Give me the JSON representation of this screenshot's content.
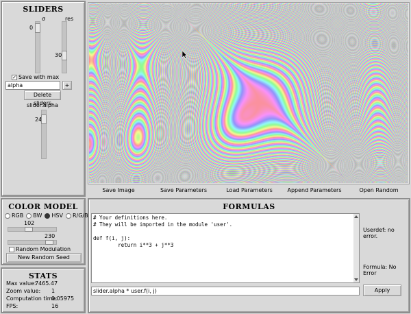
{
  "sliders": {
    "title": "SLIDERS",
    "sigma": {
      "label": "σ",
      "value": "0",
      "fraction": 0.0
    },
    "res": {
      "label": "res",
      "value": "30",
      "fraction": 0.58
    },
    "save_max_res_label": "Save with max resolution",
    "save_max_res_checked": true,
    "new_slider_value": "alpha",
    "add_button": "+",
    "delete_button": "Delete sliders",
    "alpha_slider": {
      "label": "slider.alpha",
      "value": "24",
      "fraction": 0.0
    }
  },
  "canvas_toolbar": {
    "save_image": "Save Image",
    "save_parameters": "Save Parameters",
    "load_parameters": "Load Parameters",
    "append_parameters": "Append Parameters",
    "open_random": "Open Random"
  },
  "color_model": {
    "title": "COLOR MODEL",
    "options": [
      "RGB",
      "BW",
      "HSV",
      "R/G/B"
    ],
    "selected": "HSV",
    "slider1_value": "102",
    "slider1_fraction": 0.4,
    "slider2_value": "230",
    "slider2_fraction": 0.9,
    "random_modulation_label": "Random Modulation",
    "random_modulation_checked": false,
    "new_seed_button": "New Random Seed"
  },
  "formulas": {
    "title": "FORMULAS",
    "code_lines": [
      "# Your definitions here.",
      "# They will be imported in the module 'user'.",
      "",
      "def f(i, j):",
      "        return i**3 + j**3"
    ],
    "userdef_status": "Userdef: no error.",
    "formula_status": "Formula: No Error",
    "formula_value": "slider.alpha * user.f(i, j)",
    "apply_button": "Apply"
  },
  "stats": {
    "title": "STATS",
    "rows": [
      {
        "label": "Max value:",
        "value": "7465.47"
      },
      {
        "label": "Zoom value:",
        "value": "1"
      },
      {
        "label": "Computation time:",
        "value": "0.05975"
      },
      {
        "label": "FPS:",
        "value": "16"
      }
    ]
  }
}
